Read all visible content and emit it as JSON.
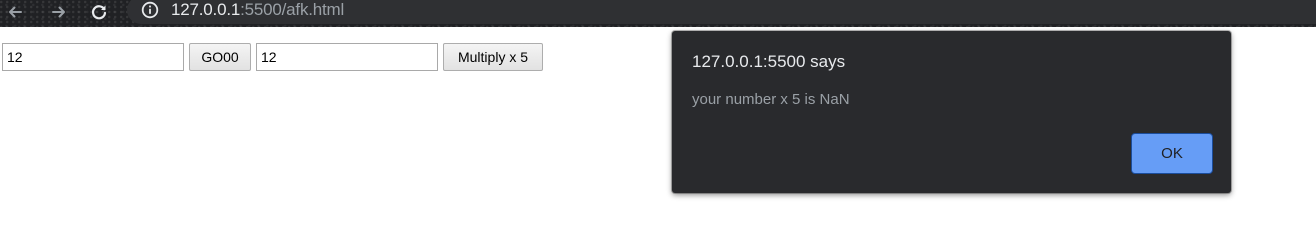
{
  "browser": {
    "url_host": "127.0.0.1",
    "url_rest": ":5500/afk.html",
    "icons": {
      "back": "back-arrow-icon",
      "forward": "forward-arrow-icon",
      "reload": "reload-icon",
      "site_info": "info-icon"
    }
  },
  "page": {
    "input_one_value": "12",
    "go_button_label": "GO00",
    "input_two_value": "12",
    "multiply_button_label": "Multiply x 5"
  },
  "alert": {
    "title": "127.0.0.1:5500 says",
    "message": "your number x 5 is NaN",
    "ok_label": "OK"
  },
  "colors": {
    "chrome_background": "#202124",
    "omnibox_background": "#2f3033",
    "dialog_background": "#292a2d",
    "ok_button": "#669df6"
  }
}
